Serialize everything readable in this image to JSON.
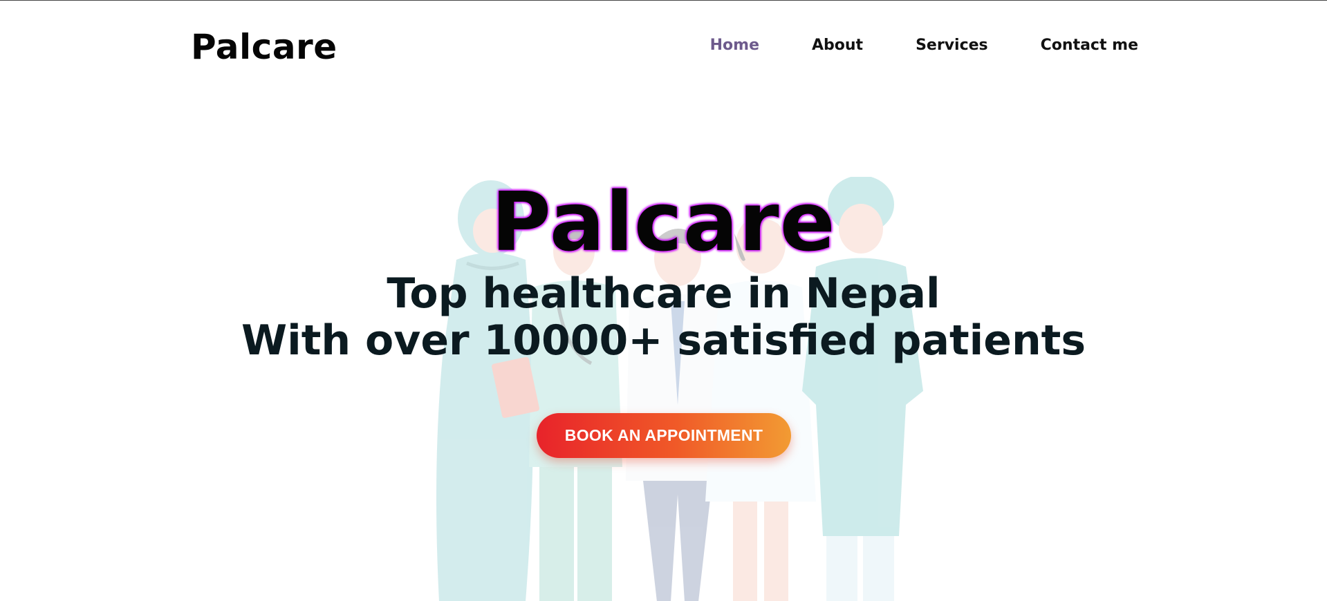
{
  "navbar": {
    "brand": "Palcare",
    "links": [
      {
        "label": "Home",
        "active": true
      },
      {
        "label": "About",
        "active": false
      },
      {
        "label": "Services",
        "active": false
      },
      {
        "label": "Contact me",
        "active": false
      }
    ]
  },
  "hero": {
    "title": "Palcare",
    "line1": "Top healthcare in Nepal",
    "line2": "With over 10000+ satisfied patients",
    "cta_label": "BOOK AN APPOINTMENT"
  },
  "colors": {
    "active_link": "#6d5a8c",
    "cta_gradient_start": "#e8232a",
    "cta_gradient_end": "#f29b33",
    "title_glow": "#d100ff"
  },
  "illustration": {
    "icon": "medical-staff-illustration"
  }
}
